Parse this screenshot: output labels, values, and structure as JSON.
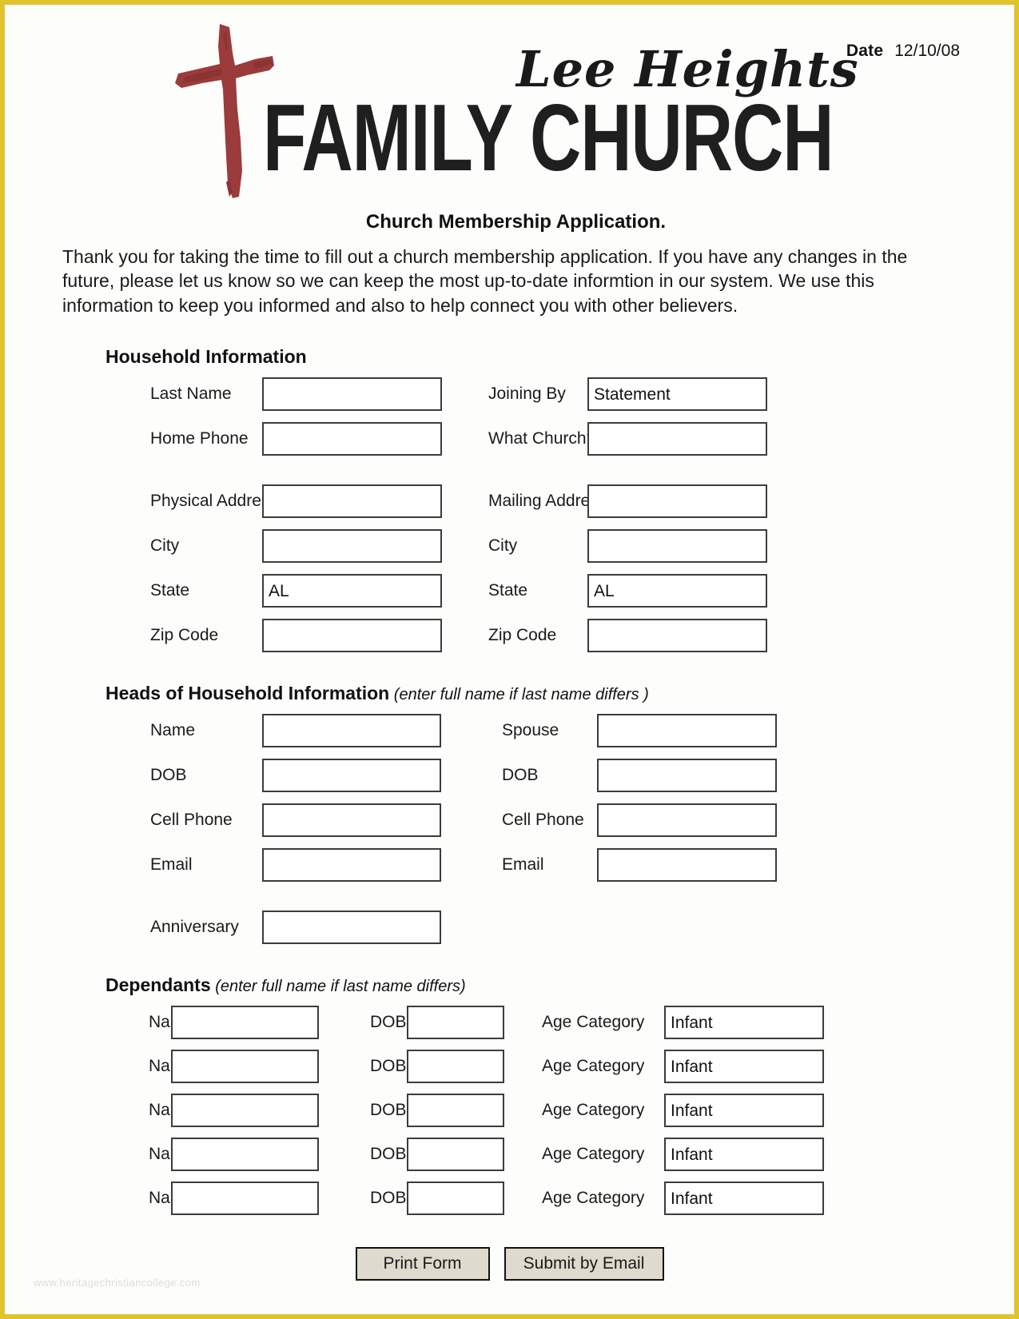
{
  "header": {
    "date_label": "Date",
    "date_value": "12/10/08",
    "logo_script": "Lee Heights",
    "logo_block": "FAMILY CHURCH",
    "cross_color": "#9b3b3b"
  },
  "intro": {
    "title": "Church Membership Application.",
    "body": "Thank you for taking the time to fill out a church membership application. If you have any changes in the future, please let us know so we can keep the most up-to-date informtion in our system. We use this information to keep you informed and also to help connect you with other believers."
  },
  "household": {
    "heading": "Household Information",
    "left": [
      {
        "label": "Last Name",
        "value": ""
      },
      {
        "label": "Home Phone",
        "value": ""
      },
      {
        "label": "Physical Address",
        "value": ""
      },
      {
        "label": "City",
        "value": ""
      },
      {
        "label": "State",
        "value": "AL"
      },
      {
        "label": "Zip Code",
        "value": ""
      }
    ],
    "right": [
      {
        "label": "Joining By",
        "value": "Statement"
      },
      {
        "label": "What Church?",
        "value": ""
      },
      {
        "label": "Mailing Address",
        "value": ""
      },
      {
        "label": "City",
        "value": ""
      },
      {
        "label": "State",
        "value": "AL"
      },
      {
        "label": "Zip Code",
        "value": ""
      }
    ]
  },
  "heads": {
    "heading": "Heads of Household Information",
    "note": " (enter full name if last name differs )",
    "left": [
      {
        "label": "Name",
        "value": ""
      },
      {
        "label": "DOB",
        "value": ""
      },
      {
        "label": "Cell Phone",
        "value": ""
      },
      {
        "label": "Email",
        "value": ""
      },
      {
        "label": "Anniversary",
        "value": ""
      }
    ],
    "right": [
      {
        "label": "Spouse",
        "value": ""
      },
      {
        "label": "DOB",
        "value": ""
      },
      {
        "label": "Cell Phone",
        "value": ""
      },
      {
        "label": "Email",
        "value": ""
      }
    ]
  },
  "dependants": {
    "heading": "Dependants",
    "note": " (enter full name if last name differs)",
    "name_label": "Name",
    "dob_label": "DOB",
    "age_label": "Age Category",
    "rows": [
      {
        "name": "",
        "dob": "",
        "age": "Infant"
      },
      {
        "name": "",
        "dob": "",
        "age": "Infant"
      },
      {
        "name": "",
        "dob": "",
        "age": "Infant"
      },
      {
        "name": "",
        "dob": "",
        "age": "Infant"
      },
      {
        "name": "",
        "dob": "",
        "age": "Infant"
      }
    ]
  },
  "buttons": {
    "print": "Print Form",
    "email": "Submit by Email"
  },
  "watermark": "www.heritagechristiancollege.com"
}
